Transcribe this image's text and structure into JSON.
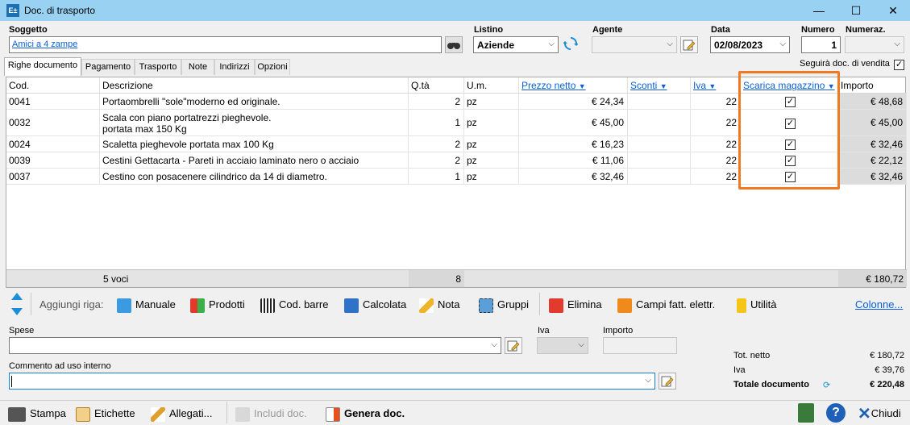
{
  "window": {
    "icon_text": "E±",
    "title": "Doc. di trasporto",
    "minimize": "—",
    "maximize": "☐",
    "close": "✕"
  },
  "header": {
    "soggetto_label": "Soggetto",
    "soggetto_value": "Amici a 4 zampe",
    "listino_label": "Listino",
    "listino_value": "Aziende",
    "agente_label": "Agente",
    "agente_value": "",
    "data_label": "Data",
    "data_value": "02/08/2023",
    "numero_label": "Numero",
    "numero_value": "1",
    "numeraz_label": "Numeraz.",
    "numeraz_value": ""
  },
  "tabs": [
    "Righe documento",
    "Pagamento",
    "Trasporto",
    "Note",
    "Indirizzi",
    "Opzioni"
  ],
  "seguira_label": "Seguirà doc. di vendita",
  "seguira_checked": true,
  "grid": {
    "columns": [
      "Cod.",
      "Descrizione",
      "Q.tà",
      "U.m.",
      "Prezzo netto",
      "Sconti",
      "Iva",
      "Scarica magazzino",
      "Importo"
    ],
    "rows": [
      {
        "cod": "0041",
        "desc": "Portaombrelli \"sole\"moderno ed originale.",
        "qta": "2",
        "um": "pz",
        "prezzo": "€ 24,34",
        "sconti": "",
        "iva": "22",
        "scarica": "☑",
        "importo": "€ 48,68"
      },
      {
        "cod": "0032",
        "desc": "Scala con piano portatrezzi pieghevole.\nportata max 150 Kg",
        "qta": "1",
        "um": "pz",
        "prezzo": "€ 45,00",
        "sconti": "",
        "iva": "22",
        "scarica": "☑",
        "importo": "€ 45,00"
      },
      {
        "cod": "0024",
        "desc": "Scaletta pieghevole portata max 100 Kg",
        "qta": "2",
        "um": "pz",
        "prezzo": "€ 16,23",
        "sconti": "",
        "iva": "22",
        "scarica": "☑",
        "importo": "€ 32,46"
      },
      {
        "cod": "0039",
        "desc": "Cestini Gettacarta - Pareti in acciaio laminato nero o acciaio",
        "qta": "2",
        "um": "pz",
        "prezzo": "€ 11,06",
        "sconti": "",
        "iva": "22",
        "scarica": "☑",
        "importo": "€ 22,12"
      },
      {
        "cod": "0037",
        "desc": "Cestino con posacenere cilindrico da 14 di diametro.",
        "qta": "1",
        "um": "pz",
        "prezzo": "€ 32,46",
        "sconti": "",
        "iva": "22",
        "scarica": "☑",
        "importo": "€ 32,46"
      }
    ],
    "footer_voci": "5 voci",
    "footer_qta": "8",
    "footer_importo": "€ 180,72"
  },
  "row_toolbar": {
    "label": "Aggiungi riga:",
    "manuale": "Manuale",
    "prodotti": "Prodotti",
    "cod_barre": "Cod. barre",
    "calcolata": "Calcolata",
    "nota": "Nota",
    "gruppi": "Gruppi",
    "elimina": "Elimina",
    "campi": "Campi fatt. elettr.",
    "utilita": "Utilità",
    "colonne": "Colonne..."
  },
  "bottom_form": {
    "spese_label": "Spese",
    "iva_label": "Iva",
    "importo_label": "Importo",
    "commento_label": "Commento ad uso interno"
  },
  "totals": {
    "netto_label": "Tot. netto",
    "netto_value": "€ 180,72",
    "iva_label": "Iva",
    "iva_value": "€ 39,76",
    "totale_label": "Totale documento",
    "totale_value": "€ 220,48"
  },
  "bottom_bar": {
    "stampa": "Stampa",
    "etichette": "Etichette",
    "allegati": "Allegati...",
    "includi": "Includi doc.",
    "genera": "Genera doc.",
    "help": "?",
    "chiudi": "Chiudi"
  },
  "colors": {
    "titlebar": "#99d1f3",
    "highlight": "#f07a24",
    "link": "#0a5fd6"
  }
}
